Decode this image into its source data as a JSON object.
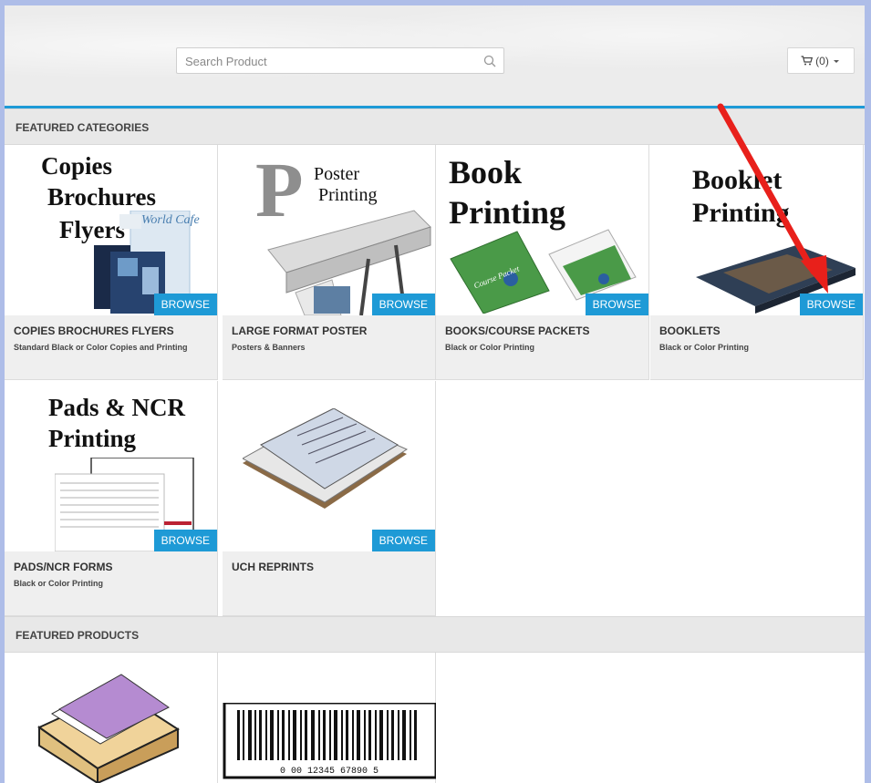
{
  "search": {
    "placeholder": "Search Product"
  },
  "cart": {
    "label": "(0)"
  },
  "sections": {
    "featured_categories": "FEATURED CATEGORIES",
    "featured_products": "FEATURED PRODUCTS"
  },
  "categories": [
    {
      "title": "COPIES BROCHURES FLYERS",
      "subtitle": "Standard Black or Color Copies and Printing",
      "browse": "BROWSE",
      "art_lines": [
        "Copies",
        "Brochures",
        "Flyers"
      ],
      "art_extra": "World Cafe"
    },
    {
      "title": "LARGE FORMAT POSTER",
      "subtitle": "Posters & Banners",
      "browse": "BROWSE",
      "art_letter": "P",
      "art_lines": [
        "Poster",
        "Printing"
      ]
    },
    {
      "title": "BOOKS/COURSE PACKETS",
      "subtitle": "Black or Color Printing",
      "browse": "BROWSE",
      "art_lines": [
        "Book",
        "Printing"
      ],
      "art_extra": "Course Packet"
    },
    {
      "title": "BOOKLETS",
      "subtitle": "Black or Color Printing",
      "browse": "BROWSE",
      "art_lines": [
        "Booklet",
        "Printing"
      ]
    },
    {
      "title": "PADS/NCR FORMS",
      "subtitle": "Black or Color Printing",
      "browse": "BROWSE",
      "art_lines": [
        "Pads & NCR",
        "Printing"
      ]
    },
    {
      "title": "UCH REPRINTS",
      "subtitle": "",
      "browse": "BROWSE"
    }
  ],
  "products": [
    {
      "icon": "paper-tray-icon"
    },
    {
      "icon": "barcode-icon",
      "barcode_text": "0 00 12345 67890 5"
    }
  ],
  "colors": {
    "accent": "#1e9ad6",
    "annotation_arrow": "#e8201b"
  }
}
